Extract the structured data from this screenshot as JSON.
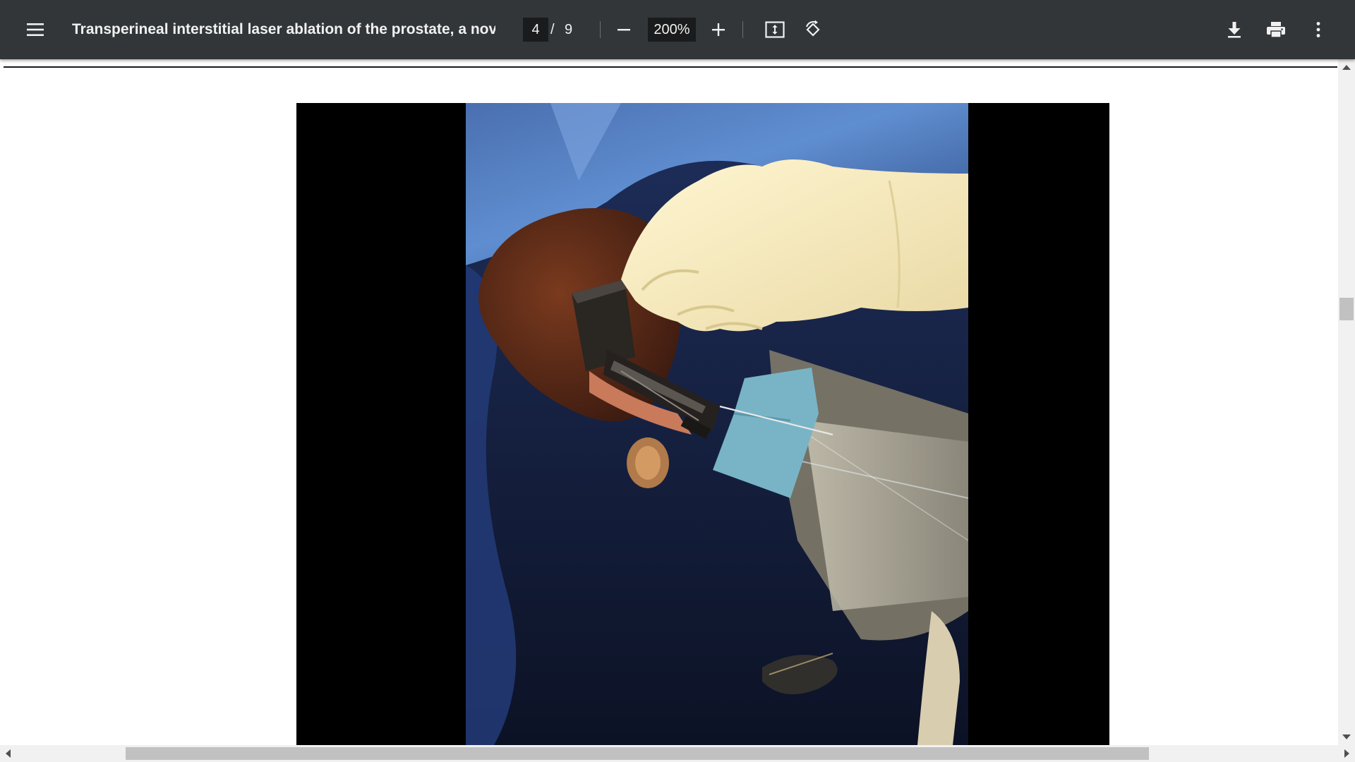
{
  "toolbar": {
    "title": "Transperineal interstitial laser ablation of the prostate, a novel ...",
    "page_current": "4",
    "page_separator": "/",
    "page_total": "9",
    "zoom": "200%",
    "icons": {
      "menu": "menu-icon",
      "zoom_out": "minus-icon",
      "zoom_in": "plus-icon",
      "fit": "fit-to-page-icon",
      "rotate": "rotate-counterclockwise-icon",
      "download": "download-icon",
      "print": "print-icon",
      "more": "more-vertical-icon"
    }
  },
  "colors": {
    "toolbar_bg": "#323639",
    "toolbar_text": "#f1f1f1",
    "input_bg": "#191b1c",
    "page_bg": "#ffffff",
    "scrollbar_track": "#f1f1f1",
    "scrollbar_thumb": "#c1c1c1"
  },
  "document": {
    "figure_description_visible": false
  }
}
